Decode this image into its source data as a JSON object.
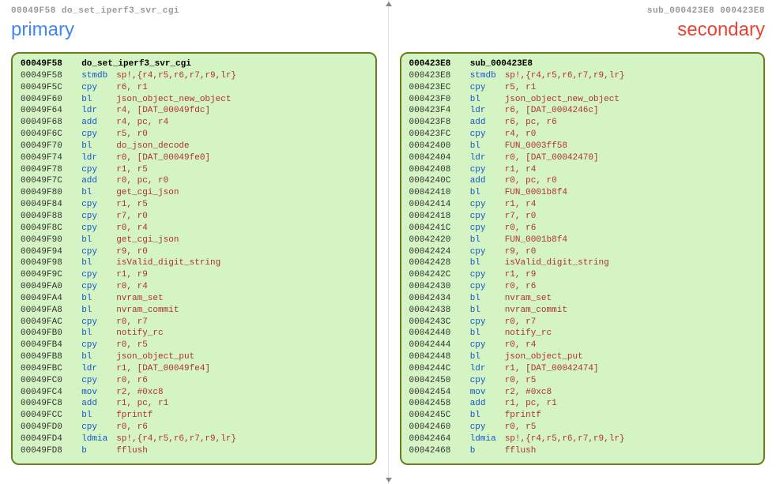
{
  "primary": {
    "header": "00049F58 do_set_iperf3_svr_cgi",
    "label": "primary",
    "fn_addr": "00049F58",
    "fn_name": "do_set_iperf3_svr_cgi",
    "rows": [
      {
        "addr": "00049F58",
        "mnem": "stmdb",
        "ops": "sp!,{r4,r5,r6,r7,r9,lr}"
      },
      {
        "addr": "00049F5C",
        "mnem": "cpy",
        "ops": "r6, r1"
      },
      {
        "addr": "00049F60",
        "mnem": "bl",
        "ops": "json_object_new_object"
      },
      {
        "addr": "00049F64",
        "mnem": "ldr",
        "ops": "r4, [DAT_00049fdc]"
      },
      {
        "addr": "00049F68",
        "mnem": "add",
        "ops": "r4, pc, r4"
      },
      {
        "addr": "00049F6C",
        "mnem": "cpy",
        "ops": "r5, r0"
      },
      {
        "addr": "00049F70",
        "mnem": "bl",
        "ops": "do_json_decode"
      },
      {
        "addr": "00049F74",
        "mnem": "ldr",
        "ops": "r0, [DAT_00049fe0]"
      },
      {
        "addr": "00049F78",
        "mnem": "cpy",
        "ops": "r1, r5"
      },
      {
        "addr": "00049F7C",
        "mnem": "add",
        "ops": "r0, pc, r0"
      },
      {
        "addr": "00049F80",
        "mnem": "bl",
        "ops": "get_cgi_json"
      },
      {
        "addr": "00049F84",
        "mnem": "cpy",
        "ops": "r1, r5"
      },
      {
        "addr": "00049F88",
        "mnem": "cpy",
        "ops": "r7, r0"
      },
      {
        "addr": "00049F8C",
        "mnem": "cpy",
        "ops": "r0, r4"
      },
      {
        "addr": "00049F90",
        "mnem": "bl",
        "ops": "get_cgi_json"
      },
      {
        "addr": "00049F94",
        "mnem": "cpy",
        "ops": "r9, r0"
      },
      {
        "addr": "00049F98",
        "mnem": "bl",
        "ops": "isValid_digit_string"
      },
      {
        "addr": "00049F9C",
        "mnem": "cpy",
        "ops": "r1, r9"
      },
      {
        "addr": "00049FA0",
        "mnem": "cpy",
        "ops": "r0, r4"
      },
      {
        "addr": "00049FA4",
        "mnem": "bl",
        "ops": "nvram_set"
      },
      {
        "addr": "00049FA8",
        "mnem": "bl",
        "ops": "nvram_commit"
      },
      {
        "addr": "00049FAC",
        "mnem": "cpy",
        "ops": "r0, r7"
      },
      {
        "addr": "00049FB0",
        "mnem": "bl",
        "ops": "notify_rc"
      },
      {
        "addr": "00049FB4",
        "mnem": "cpy",
        "ops": "r0, r5"
      },
      {
        "addr": "00049FB8",
        "mnem": "bl",
        "ops": "json_object_put"
      },
      {
        "addr": "00049FBC",
        "mnem": "ldr",
        "ops": "r1, [DAT_00049fe4]"
      },
      {
        "addr": "00049FC0",
        "mnem": "cpy",
        "ops": "r0, r6"
      },
      {
        "addr": "00049FC4",
        "mnem": "mov",
        "ops": "r2, #0xc8"
      },
      {
        "addr": "00049FC8",
        "mnem": "add",
        "ops": "r1, pc, r1"
      },
      {
        "addr": "00049FCC",
        "mnem": "bl",
        "ops": "fprintf"
      },
      {
        "addr": "00049FD0",
        "mnem": "cpy",
        "ops": "r0, r6"
      },
      {
        "addr": "00049FD4",
        "mnem": "ldmia",
        "ops": "sp!,{r4,r5,r6,r7,r9,lr}"
      },
      {
        "addr": "00049FD8",
        "mnem": "b",
        "ops": "fflush"
      }
    ]
  },
  "secondary": {
    "header": "sub_000423E8 000423E8",
    "label": "secondary",
    "fn_addr": "000423E8",
    "fn_name": "sub_000423E8",
    "rows": [
      {
        "addr": "000423E8",
        "mnem": "stmdb",
        "ops": "sp!,{r4,r5,r6,r7,r9,lr}"
      },
      {
        "addr": "000423EC",
        "mnem": "cpy",
        "ops": "r5, r1"
      },
      {
        "addr": "000423F0",
        "mnem": "bl",
        "ops": "json_object_new_object"
      },
      {
        "addr": "000423F4",
        "mnem": "ldr",
        "ops": "r6, [DAT_0004246c]"
      },
      {
        "addr": "000423F8",
        "mnem": "add",
        "ops": "r6, pc, r6"
      },
      {
        "addr": "000423FC",
        "mnem": "cpy",
        "ops": "r4, r0"
      },
      {
        "addr": "00042400",
        "mnem": "bl",
        "ops": "FUN_0003ff58"
      },
      {
        "addr": "00042404",
        "mnem": "ldr",
        "ops": "r0, [DAT_00042470]"
      },
      {
        "addr": "00042408",
        "mnem": "cpy",
        "ops": "r1, r4"
      },
      {
        "addr": "0004240C",
        "mnem": "add",
        "ops": "r0, pc, r0"
      },
      {
        "addr": "00042410",
        "mnem": "bl",
        "ops": "FUN_0001b8f4"
      },
      {
        "addr": "00042414",
        "mnem": "cpy",
        "ops": "r1, r4"
      },
      {
        "addr": "00042418",
        "mnem": "cpy",
        "ops": "r7, r0"
      },
      {
        "addr": "0004241C",
        "mnem": "cpy",
        "ops": "r0, r6"
      },
      {
        "addr": "00042420",
        "mnem": "bl",
        "ops": "FUN_0001b8f4"
      },
      {
        "addr": "00042424",
        "mnem": "cpy",
        "ops": "r9, r0"
      },
      {
        "addr": "00042428",
        "mnem": "bl",
        "ops": "isValid_digit_string"
      },
      {
        "addr": "0004242C",
        "mnem": "cpy",
        "ops": "r1, r9"
      },
      {
        "addr": "00042430",
        "mnem": "cpy",
        "ops": "r0, r6"
      },
      {
        "addr": "00042434",
        "mnem": "bl",
        "ops": "nvram_set"
      },
      {
        "addr": "00042438",
        "mnem": "bl",
        "ops": "nvram_commit"
      },
      {
        "addr": "0004243C",
        "mnem": "cpy",
        "ops": "r0, r7"
      },
      {
        "addr": "00042440",
        "mnem": "bl",
        "ops": "notify_rc"
      },
      {
        "addr": "00042444",
        "mnem": "cpy",
        "ops": "r0, r4"
      },
      {
        "addr": "00042448",
        "mnem": "bl",
        "ops": "json_object_put"
      },
      {
        "addr": "0004244C",
        "mnem": "ldr",
        "ops": "r1, [DAT_00042474]"
      },
      {
        "addr": "00042450",
        "mnem": "cpy",
        "ops": "r0, r5"
      },
      {
        "addr": "00042454",
        "mnem": "mov",
        "ops": "r2, #0xc8"
      },
      {
        "addr": "00042458",
        "mnem": "add",
        "ops": "r1, pc, r1"
      },
      {
        "addr": "0004245C",
        "mnem": "bl",
        "ops": "fprintf"
      },
      {
        "addr": "00042460",
        "mnem": "cpy",
        "ops": "r0, r5"
      },
      {
        "addr": "00042464",
        "mnem": "ldmia",
        "ops": "sp!,{r4,r5,r6,r7,r9,lr}"
      },
      {
        "addr": "00042468",
        "mnem": "b",
        "ops": "fflush"
      }
    ]
  }
}
